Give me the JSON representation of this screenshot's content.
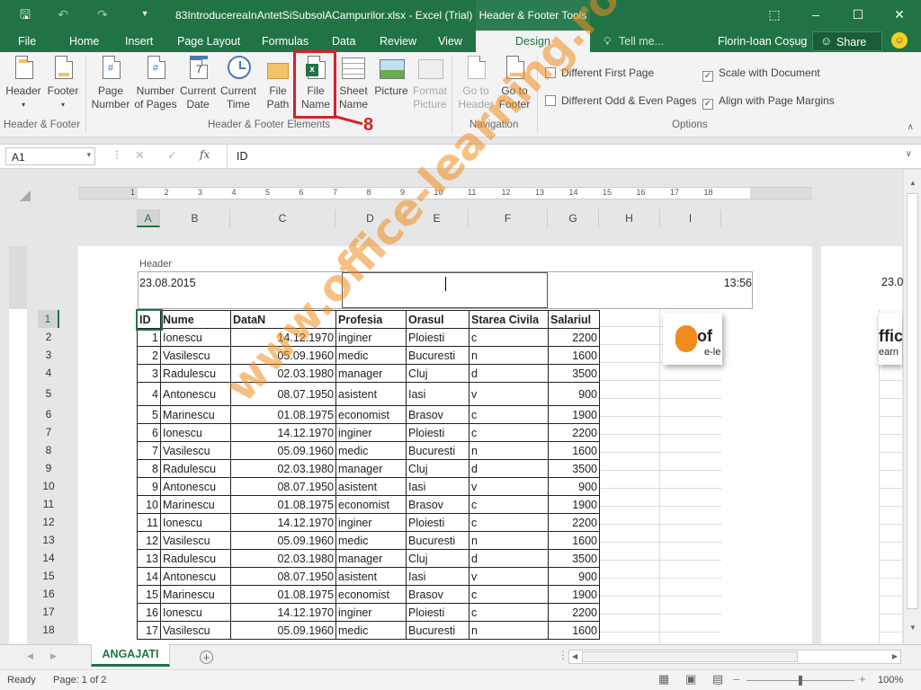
{
  "window": {
    "title": "83IntroducereaInAntetSiSubsolACampurilor.xlsx - Excel (Trial)",
    "context_tab_title": "Header & Footer Tools",
    "user": "Florin-Ioan Coșug",
    "share": "Share"
  },
  "tabs": [
    "File",
    "Home",
    "Insert",
    "Page Layout",
    "Formulas",
    "Data",
    "Review",
    "View",
    "Design"
  ],
  "tell_me": "Tell me...",
  "ribbon": {
    "header_footer": {
      "header": "Header",
      "footer": "Footer",
      "group": "Header & Footer"
    },
    "elements": {
      "page_number_1": "Page",
      "page_number_2": "Number",
      "number_pages_1": "Number",
      "number_pages_2": "of Pages",
      "current_date_1": "Current",
      "current_date_2": "Date",
      "current_time_1": "Current",
      "current_time_2": "Time",
      "file_path_1": "File",
      "file_path_2": "Path",
      "file_name_1": "File",
      "file_name_2": "Name",
      "sheet_name_1": "Sheet",
      "sheet_name_2": "Name",
      "picture": "Picture",
      "format_picture_1": "Format",
      "format_picture_2": "Picture",
      "group": "Header & Footer Elements"
    },
    "navigation": {
      "goto_header_1": "Go to",
      "goto_header_2": "Header",
      "goto_footer_1": "Go to",
      "goto_footer_2": "Footer",
      "group": "Navigation"
    },
    "options": {
      "diff_first": "Different First Page",
      "diff_odd_even": "Different Odd & Even Pages",
      "scale_doc": "Scale with Document",
      "align_margins": "Align with Page Margins",
      "group": "Options"
    }
  },
  "annotation_number": "8",
  "formula_bar": {
    "name_box": "A1",
    "fx": "fx",
    "content": "ID"
  },
  "ruler_ticks": [
    "1",
    "2",
    "3",
    "4",
    "5",
    "6",
    "7",
    "8",
    "9",
    "10",
    "11",
    "12",
    "13",
    "14",
    "15",
    "16",
    "17",
    "18"
  ],
  "columns": [
    "A",
    "B",
    "C",
    "D",
    "E",
    "F",
    "G",
    "H",
    "I"
  ],
  "header_area": {
    "label": "Header",
    "left": "23.08.2015",
    "right": "13:56",
    "page2_left": "23.0"
  },
  "rows": [
    "1",
    "2",
    "3",
    "4",
    "5",
    "6",
    "7",
    "8",
    "9",
    "10",
    "11",
    "12",
    "13",
    "14",
    "15",
    "16",
    "17",
    "18"
  ],
  "table": {
    "headers": [
      "ID",
      "Nume",
      "DataN",
      "Profesia",
      "Orasul",
      "Starea Civila",
      "Salariul"
    ],
    "rows": [
      [
        "1",
        "Ionescu",
        "14.12.1970",
        "inginer",
        "Ploiesti",
        "c",
        "2200"
      ],
      [
        "2",
        "Vasilescu",
        "05.09.1960",
        "medic",
        "Bucuresti",
        "n",
        "1600"
      ],
      [
        "3",
        "Radulescu",
        "02.03.1980",
        "manager",
        "Cluj",
        "d",
        "3500"
      ],
      [
        "4",
        "Antonescu",
        "08.07.1950",
        "asistent",
        "Iasi",
        "v",
        "900"
      ],
      [
        "5",
        "Marinescu",
        "01.08.1975",
        "economist",
        "Brasov",
        "c",
        "1900"
      ],
      [
        "6",
        "Ionescu",
        "14.12.1970",
        "inginer",
        "Ploiesti",
        "c",
        "2200"
      ],
      [
        "7",
        "Vasilescu",
        "05.09.1960",
        "medic",
        "Bucuresti",
        "n",
        "1600"
      ],
      [
        "8",
        "Radulescu",
        "02.03.1980",
        "manager",
        "Cluj",
        "d",
        "3500"
      ],
      [
        "9",
        "Antonescu",
        "08.07.1950",
        "asistent",
        "Iasi",
        "v",
        "900"
      ],
      [
        "10",
        "Marinescu",
        "01.08.1975",
        "economist",
        "Brasov",
        "c",
        "1900"
      ],
      [
        "11",
        "Ionescu",
        "14.12.1970",
        "inginer",
        "Ploiesti",
        "c",
        "2200"
      ],
      [
        "12",
        "Vasilescu",
        "05.09.1960",
        "medic",
        "Bucuresti",
        "n",
        "1600"
      ],
      [
        "13",
        "Radulescu",
        "02.03.1980",
        "manager",
        "Cluj",
        "d",
        "3500"
      ],
      [
        "14",
        "Antonescu",
        "08.07.1950",
        "asistent",
        "Iasi",
        "v",
        "900"
      ],
      [
        "15",
        "Marinescu",
        "01.08.1975",
        "economist",
        "Brasov",
        "c",
        "1900"
      ],
      [
        "16",
        "Ionescu",
        "14.12.1970",
        "inginer",
        "Ploiesti",
        "c",
        "2200"
      ],
      [
        "17",
        "Vasilescu",
        "05.09.1960",
        "medic",
        "Bucuresti",
        "n",
        "1600"
      ]
    ]
  },
  "logo_text": {
    "a": "of",
    "b": "e-le",
    "c": "ffic",
    "d": "earn"
  },
  "watermark": "www.office-learning.ro",
  "sheet_tab": "ANGAJATI",
  "status": {
    "ready": "Ready",
    "page": "Page: 1 of 2",
    "zoom": "100%"
  },
  "colors": {
    "excel_green": "#217346",
    "highlight_red": "#d7202a",
    "watermark": "#f08c1e"
  }
}
